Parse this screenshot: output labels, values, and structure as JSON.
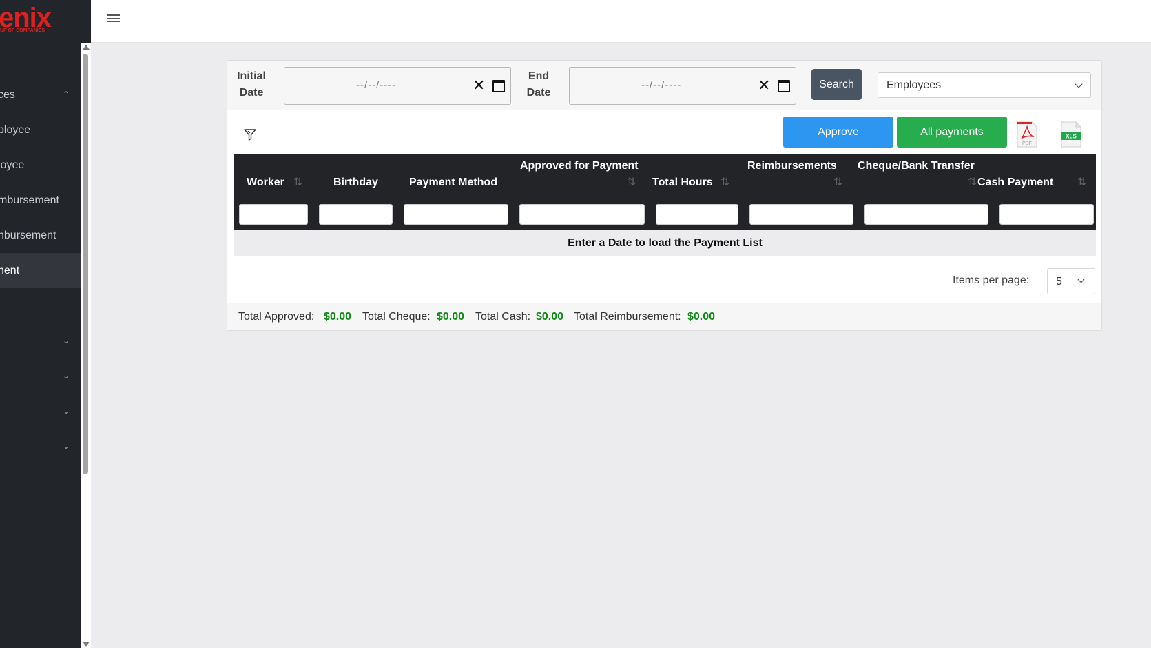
{
  "sidebar": {
    "logo": "enix",
    "logo_sub": "UP OF COMPANIES",
    "items": [
      {
        "label": "ces",
        "chevron": "chevron-up"
      },
      {
        "label": "ployee"
      },
      {
        "label": "loyee"
      },
      {
        "label": "mbursement"
      },
      {
        "label": "nbursement"
      },
      {
        "label": "nent",
        "active": true
      },
      {
        "label": "",
        "chevron": "chevron-down"
      },
      {
        "label": "",
        "chevron": "chevron-down"
      },
      {
        "label": "",
        "chevron": "chevron-down"
      },
      {
        "label": "",
        "chevron": "chevron-down"
      }
    ]
  },
  "topbar": {
    "menu_icon": "hamburger-icon"
  },
  "filters": {
    "initial_label": "Initial Date",
    "end_label": "End Date",
    "date_placeholder": "--/--/----",
    "search_label": "Search",
    "employee_select": "Employees"
  },
  "actions": {
    "approve_label": "Approve",
    "all_payments_label": "All payments",
    "pdf_label": "PDF",
    "xls_label": "XLS"
  },
  "table": {
    "columns": [
      "Worker",
      "Birthday",
      "Payment Method",
      "Approved for Payment",
      "Total Hours",
      "Reimbursements",
      "Cheque/Bank Transfer",
      "Cash Payment"
    ],
    "empty_message": "Enter a Date to load the Payment List"
  },
  "pagination": {
    "items_per_page_label": "Items per page:",
    "items_per_page": "5"
  },
  "totals": {
    "approved_label": "Total Approved:",
    "approved": "$0.00",
    "cheque_label": "Total Cheque:",
    "cheque": "$0.00",
    "cash_label": "Total Cash:",
    "cash": "$0.00",
    "reimb_label": "Total Reimbursement:",
    "reimb": "$0.00"
  },
  "colors": {
    "approve": "#2d96f0",
    "all_payments": "#27ad4e",
    "search": "#4a5564",
    "total_value": "#0f8a16"
  }
}
